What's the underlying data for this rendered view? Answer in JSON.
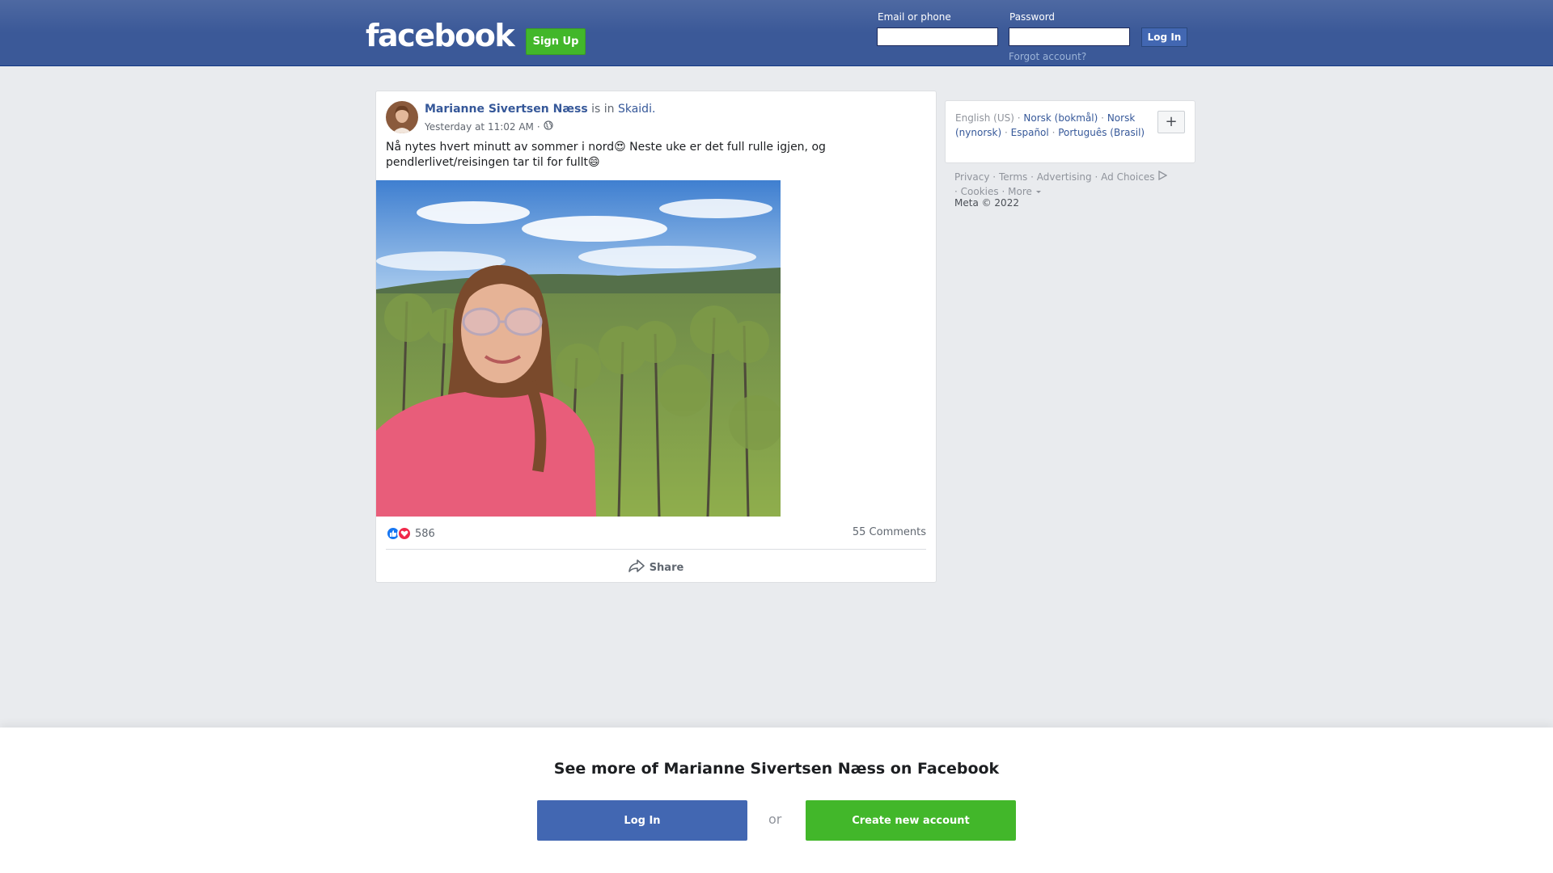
{
  "header": {
    "logo_text": "facebook",
    "signup_label": "Sign Up",
    "email_label": "Email or phone",
    "password_label": "Password",
    "login_label": "Log In",
    "forgot_label": "Forgot account?"
  },
  "post": {
    "author": "Marianne Sivertsen Næss",
    "is_in": "is in",
    "place": "Skaidi.",
    "timestamp": "Yesterday at 11:02 AM",
    "meta_separator": "·",
    "privacy_icon": "globe-icon",
    "text": "Nå nytes hvert minutt av sommer i nord😍 Neste uke er det full rulle igjen, og pendlerlivet/reisingen tar til for fullt😄",
    "reaction_icons": [
      "like-icon",
      "love-icon"
    ],
    "reaction_count": "586",
    "comments_label": "55 Comments",
    "share_label": "Share"
  },
  "sidebar": {
    "current_language": "English (US)",
    "languages": [
      "Norsk (bokmål)",
      "Norsk (nynorsk)",
      "Español",
      "Português (Brasil)"
    ],
    "separator": "·",
    "add_language_label": "+",
    "footer_links": [
      "Privacy",
      "Terms",
      "Advertising",
      "Ad Choices",
      "Cookies",
      "More"
    ],
    "copyright": "Meta © 2022"
  },
  "banner": {
    "title": "See more of Marianne Sivertsen Næss on Facebook",
    "login_label": "Log In",
    "or_label": "or",
    "create_label": "Create new account"
  },
  "colors": {
    "brand_blue": "#3b5998",
    "link_blue": "#365899",
    "green": "#42b72a",
    "login_blue": "#4267b2"
  }
}
